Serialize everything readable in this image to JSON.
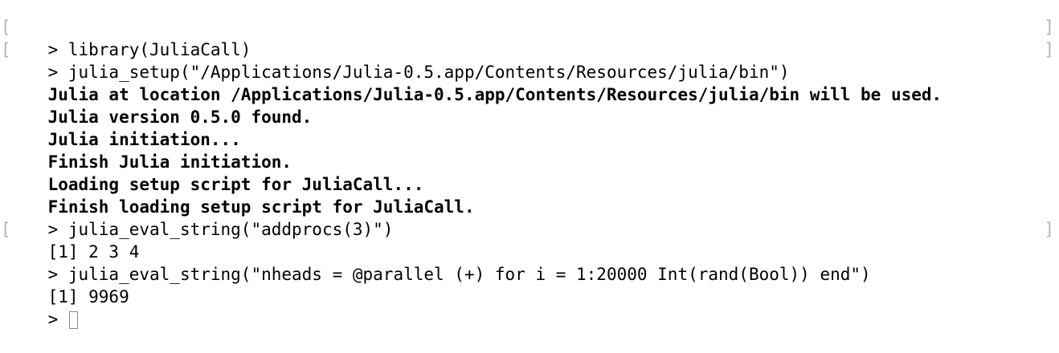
{
  "console": {
    "prompt": ">",
    "bracket_left": "[",
    "bracket_right": "]",
    "lines": [
      {
        "type": "input",
        "text": "> library(JuliaCall)"
      },
      {
        "type": "input",
        "text": "> julia_setup(\"/Applications/Julia-0.5.app/Contents/Resources/julia/bin\")"
      },
      {
        "type": "output",
        "text": "Julia at location /Applications/Julia-0.5.app/Contents/Resources/julia/bin will be used."
      },
      {
        "type": "output",
        "text": "Julia version 0.5.0 found."
      },
      {
        "type": "output",
        "text": "Julia initiation..."
      },
      {
        "type": "output",
        "text": "Finish Julia initiation."
      },
      {
        "type": "output",
        "text": "Loading setup script for JuliaCall..."
      },
      {
        "type": "output",
        "text": "Finish loading setup script for JuliaCall."
      },
      {
        "type": "input",
        "text": "> julia_eval_string(\"addprocs(3)\")"
      },
      {
        "type": "result",
        "text": "[1] 2 3 4"
      },
      {
        "type": "input",
        "text": "> julia_eval_string(\"nheads = @parallel (+) for i = 1:20000 Int(rand(Bool)) end\")"
      },
      {
        "type": "result",
        "text": "[1] 9969"
      }
    ]
  }
}
